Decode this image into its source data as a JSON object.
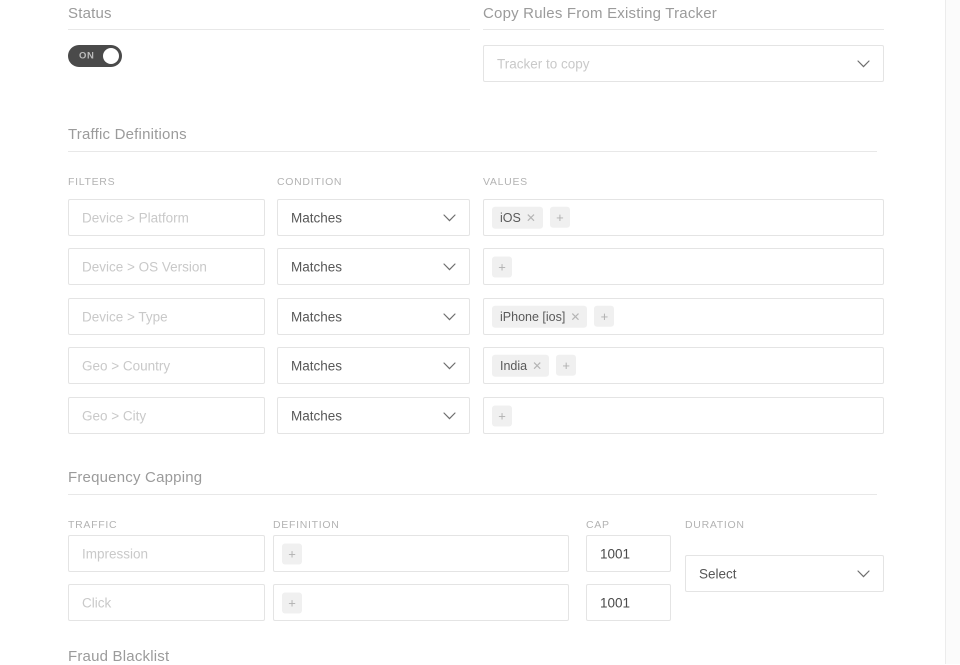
{
  "sections": {
    "status": {
      "title": "Status"
    },
    "copy_rules": {
      "title": "Copy Rules From Existing Tracker"
    },
    "traffic_definitions": {
      "title": "Traffic Definitions"
    },
    "frequency_capping": {
      "title": "Frequency Capping"
    },
    "fraud_blacklist": {
      "title": "Fraud Blacklist"
    }
  },
  "status_toggle": {
    "label": "ON",
    "state": "on",
    "on_color": "#4a4a4a",
    "knob_color": "#ffffff"
  },
  "copy_rules": {
    "select_placeholder": "Tracker to copy",
    "chevron_icon": "chevron-down-icon"
  },
  "traffic_definitions": {
    "columns": {
      "filters": "FILTERS",
      "condition": "CONDITION",
      "values": "VALUES"
    },
    "rows": [
      {
        "filter_placeholder": "Device > Platform",
        "condition": "Matches",
        "values": [
          {
            "label": "iOS",
            "remove_icon": "close-icon"
          }
        ],
        "add_label": "+"
      },
      {
        "filter_placeholder": "Device > OS Version",
        "condition": "Matches",
        "values": [],
        "add_label": "+"
      },
      {
        "filter_placeholder": "Device > Type",
        "condition": "Matches",
        "values": [
          {
            "label": "iPhone [ios]",
            "remove_icon": "close-icon"
          }
        ],
        "add_label": "+"
      },
      {
        "filter_placeholder": "Geo > Country",
        "condition": "Matches",
        "values": [
          {
            "label": "India",
            "remove_icon": "close-icon"
          }
        ],
        "add_label": "+"
      },
      {
        "filter_placeholder": "Geo > City",
        "condition": "Matches",
        "values": [],
        "add_label": "+"
      }
    ]
  },
  "frequency_capping": {
    "columns": {
      "traffic": "TRAFFIC",
      "definition": "DEFINITION",
      "cap": "CAP",
      "duration": "DURATION"
    },
    "rows": [
      {
        "traffic_placeholder": "Impression",
        "definition_add": "+",
        "cap_value": "1001"
      },
      {
        "traffic_placeholder": "Click",
        "definition_add": "+",
        "cap_value": "1001"
      }
    ],
    "duration": {
      "select_placeholder": "Select",
      "chevron_icon": "chevron-down-icon"
    }
  },
  "theme": {
    "border": "#e4e4e4",
    "rule": "#e8e8e8",
    "heading": "#9b9b9b",
    "label": "#b3b3b3",
    "placeholder": "#c9c9c9",
    "value": "#4a4a4a",
    "chip_bg": "#f0f0f0"
  }
}
